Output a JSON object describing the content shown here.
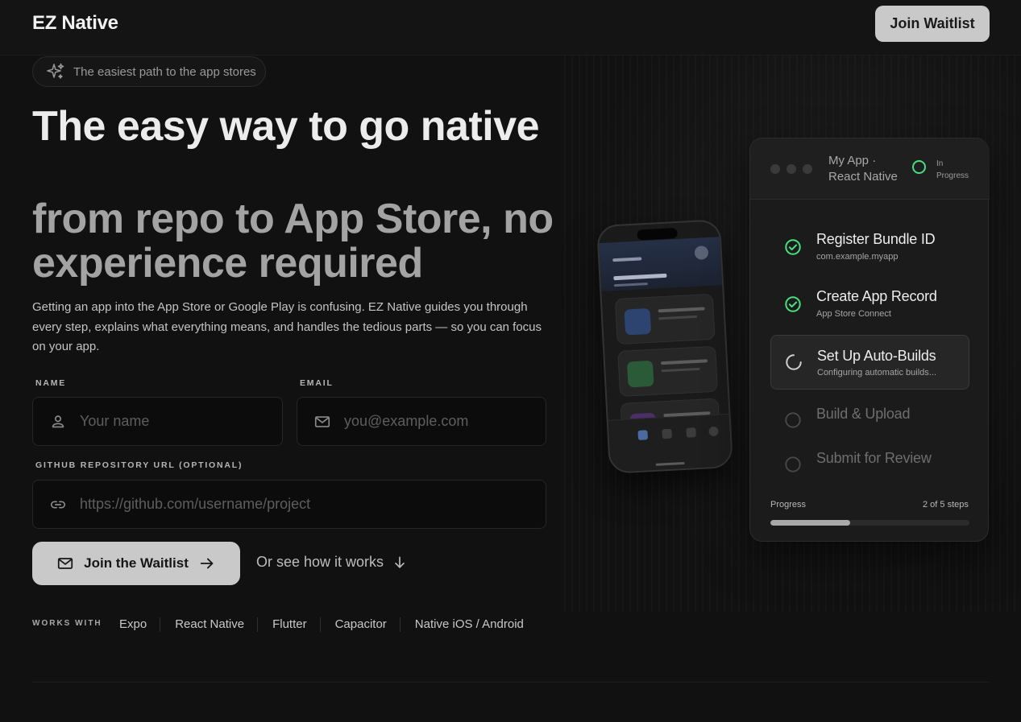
{
  "header": {
    "logo": "EZ Native",
    "cta_label": "Join Waitlist"
  },
  "hero": {
    "badge": {
      "icon": "sparkles-icon",
      "text": "The easiest path to the app stores"
    },
    "title_line1": "The easy way to go native",
    "title_line2": "from repo to App Store, no experience required",
    "description": "Getting an app into the App Store or Google Play is confusing. EZ Native guides you through every step, explains what everything means, and handles the tedious parts — so you can focus on your app."
  },
  "form": {
    "name": {
      "label": "NAME",
      "placeholder": "Your name",
      "value": "",
      "icon": "user-icon"
    },
    "email": {
      "label": "EMAIL",
      "placeholder": "you@example.com",
      "value": "",
      "icon": "mail-icon"
    },
    "repo": {
      "label": "GITHUB REPOSITORY URL (OPTIONAL)",
      "placeholder": "https://github.com/username/project",
      "value": "",
      "icon": "link-icon"
    },
    "submit_label": "Join the Waitlist",
    "secondary_label": "Or see how it works"
  },
  "works_with": {
    "label": "WORKS WITH",
    "items": [
      "Expo",
      "React Native",
      "Flutter",
      "Capacitor",
      "Native iOS / Android"
    ]
  },
  "panel": {
    "app_name": "My App · React Native",
    "status": "In Progress",
    "status_color": "#4ade80",
    "steps": [
      {
        "title": "Register Bundle ID",
        "subtitle": "com.example.myapp",
        "state": "done"
      },
      {
        "title": "Create App Record",
        "subtitle": "App Store Connect",
        "state": "done"
      },
      {
        "title": "Set Up Auto-Builds",
        "subtitle": "Configuring automatic builds...",
        "state": "active"
      },
      {
        "title": "Build & Upload",
        "subtitle": "",
        "state": "pending"
      },
      {
        "title": "Submit for Review",
        "subtitle": "",
        "state": "pending"
      }
    ],
    "progress_label": "Progress",
    "progress_count": "2 of 5 steps",
    "progress_fraction": 0.4
  },
  "colors": {
    "background": "#111111",
    "accent_button": "#c9c9c9",
    "done_green": "#4ade80"
  }
}
